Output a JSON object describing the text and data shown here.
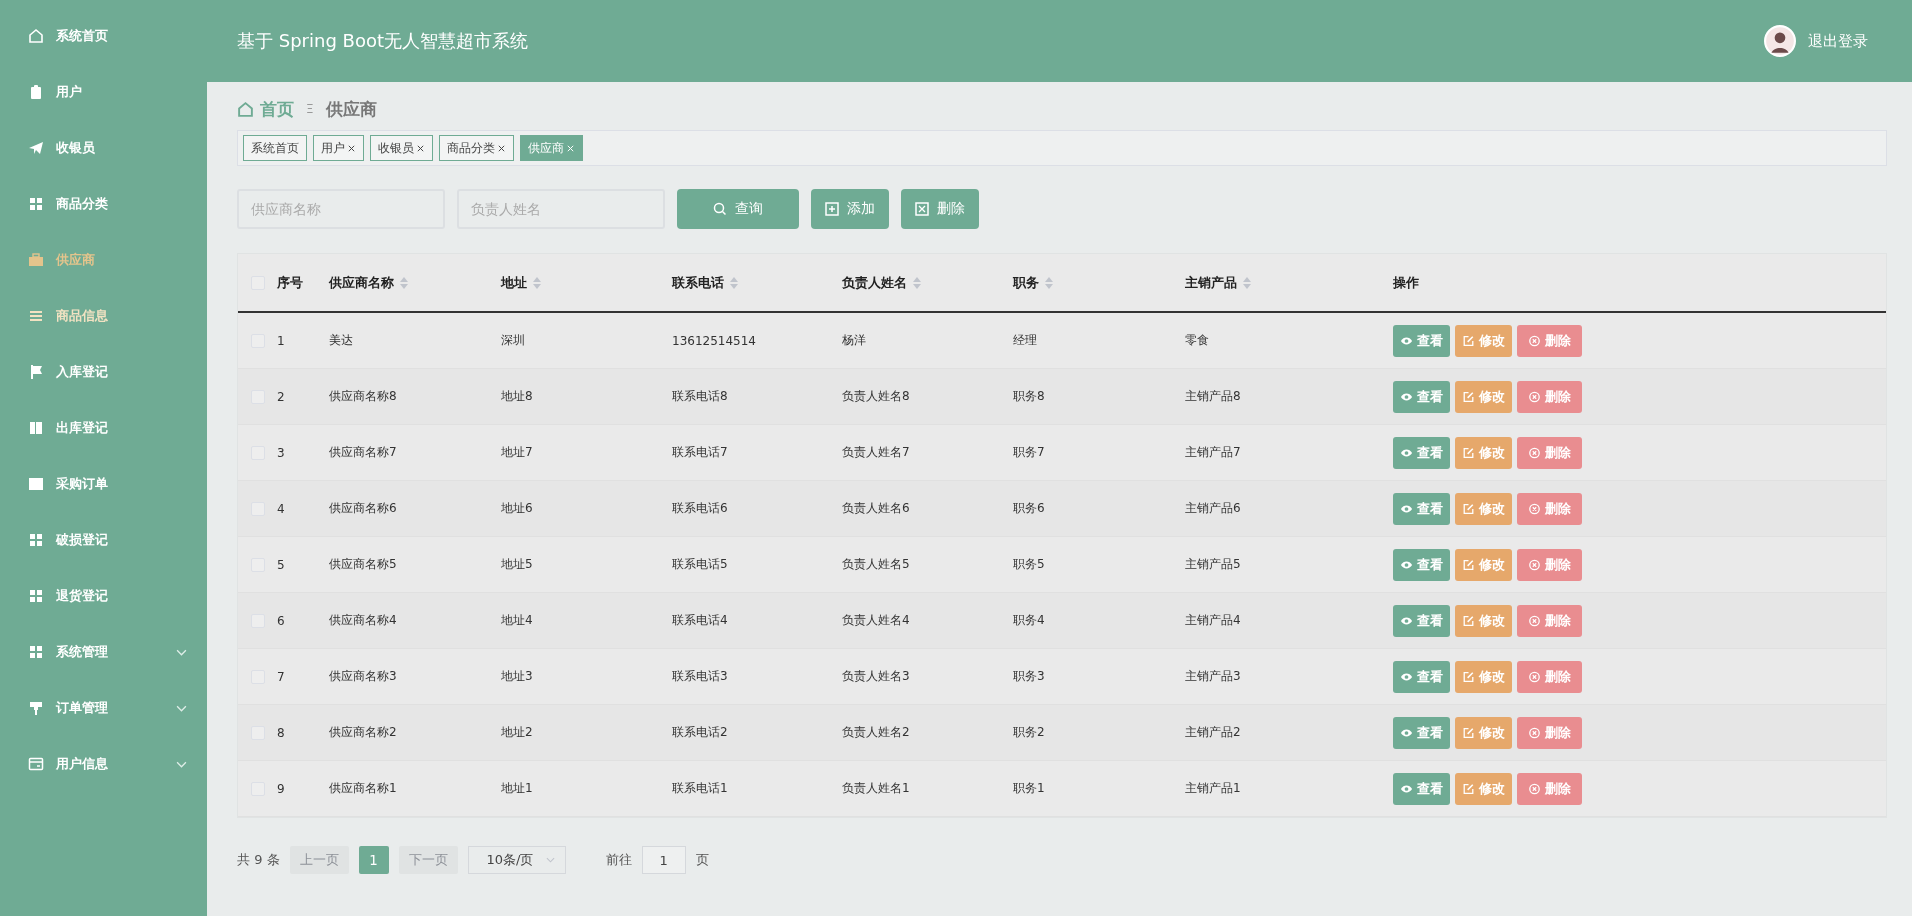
{
  "sidebar": {
    "items": [
      {
        "label": "系统首页",
        "kind": "link",
        "selected": false,
        "hovered": false
      },
      {
        "label": "用户",
        "kind": "link",
        "selected": false,
        "hovered": false
      },
      {
        "label": "收银员",
        "kind": "link",
        "selected": false,
        "hovered": false
      },
      {
        "label": "商品分类",
        "kind": "link",
        "selected": false,
        "hovered": false
      },
      {
        "label": "供应商",
        "kind": "link",
        "selected": true,
        "hovered": false
      },
      {
        "label": "商品信息",
        "kind": "link",
        "selected": false,
        "hovered": true
      },
      {
        "label": "入库登记",
        "kind": "link",
        "selected": false,
        "hovered": false
      },
      {
        "label": "出库登记",
        "kind": "link",
        "selected": false,
        "hovered": false
      },
      {
        "label": "采购订单",
        "kind": "link",
        "selected": false,
        "hovered": false
      },
      {
        "label": "破损登记",
        "kind": "link",
        "selected": false,
        "hovered": false
      },
      {
        "label": "退货登记",
        "kind": "link",
        "selected": false,
        "hovered": false
      },
      {
        "label": "系统管理",
        "kind": "submenu",
        "selected": false,
        "hovered": false
      },
      {
        "label": "订单管理",
        "kind": "submenu",
        "selected": false,
        "hovered": false
      },
      {
        "label": "用户信息",
        "kind": "submenu",
        "selected": false,
        "hovered": false
      }
    ]
  },
  "header": {
    "title": "基于 Spring Boot无人智慧超市系统",
    "logout": "退出登录"
  },
  "breadcrumb": {
    "home": "首页",
    "separator": "Ξ",
    "current": "供应商"
  },
  "tags": [
    {
      "label": "系统首页",
      "closable": false,
      "selected": false
    },
    {
      "label": "用户",
      "closable": true,
      "selected": false
    },
    {
      "label": "收银员",
      "closable": true,
      "selected": false
    },
    {
      "label": "商品分类",
      "closable": true,
      "selected": false
    },
    {
      "label": "供应商",
      "closable": true,
      "selected": true
    }
  ],
  "search": {
    "fields": [
      {
        "placeholder": "供应商名称"
      },
      {
        "placeholder": "负责人姓名"
      }
    ],
    "buttons": [
      {
        "label": "查询",
        "kind": "search"
      },
      {
        "label": "添加",
        "kind": "add"
      },
      {
        "label": "删除",
        "kind": "delete"
      }
    ]
  },
  "table": {
    "all_checked": false,
    "columns": [
      {
        "label": "序号",
        "sortable": false
      },
      {
        "label": "供应商名称",
        "sortable": true
      },
      {
        "label": "地址",
        "sortable": true
      },
      {
        "label": "联系电话",
        "sortable": true
      },
      {
        "label": "负责人姓名",
        "sortable": true
      },
      {
        "label": "职务",
        "sortable": true
      },
      {
        "label": "主销产品",
        "sortable": true
      },
      {
        "label": "操作",
        "sortable": false
      }
    ],
    "rows": [
      {
        "checked": false,
        "cells": [
          "1",
          "美达",
          "深圳",
          "13612514514",
          "杨洋",
          "经理",
          "零食"
        ],
        "actions": [
          {
            "label": "查看",
            "kind": "view"
          },
          {
            "label": "修改",
            "kind": "edit"
          },
          {
            "label": "删除",
            "kind": "delete"
          }
        ]
      },
      {
        "checked": false,
        "cells": [
          "2",
          "供应商名称8",
          "地址8",
          "联系电话8",
          "负责人姓名8",
          "职务8",
          "主销产品8"
        ],
        "actions": [
          {
            "label": "查看",
            "kind": "view"
          },
          {
            "label": "修改",
            "kind": "edit"
          },
          {
            "label": "删除",
            "kind": "delete"
          }
        ]
      },
      {
        "checked": false,
        "cells": [
          "3",
          "供应商名称7",
          "地址7",
          "联系电话7",
          "负责人姓名7",
          "职务7",
          "主销产品7"
        ],
        "actions": [
          {
            "label": "查看",
            "kind": "view"
          },
          {
            "label": "修改",
            "kind": "edit"
          },
          {
            "label": "删除",
            "kind": "delete"
          }
        ]
      },
      {
        "checked": false,
        "cells": [
          "4",
          "供应商名称6",
          "地址6",
          "联系电话6",
          "负责人姓名6",
          "职务6",
          "主销产品6"
        ],
        "actions": [
          {
            "label": "查看",
            "kind": "view"
          },
          {
            "label": "修改",
            "kind": "edit"
          },
          {
            "label": "删除",
            "kind": "delete"
          }
        ]
      },
      {
        "checked": false,
        "cells": [
          "5",
          "供应商名称5",
          "地址5",
          "联系电话5",
          "负责人姓名5",
          "职务5",
          "主销产品5"
        ],
        "actions": [
          {
            "label": "查看",
            "kind": "view"
          },
          {
            "label": "修改",
            "kind": "edit"
          },
          {
            "label": "删除",
            "kind": "delete"
          }
        ]
      },
      {
        "checked": false,
        "cells": [
          "6",
          "供应商名称4",
          "地址4",
          "联系电话4",
          "负责人姓名4",
          "职务4",
          "主销产品4"
        ],
        "actions": [
          {
            "label": "查看",
            "kind": "view"
          },
          {
            "label": "修改",
            "kind": "edit"
          },
          {
            "label": "删除",
            "kind": "delete"
          }
        ]
      },
      {
        "checked": false,
        "cells": [
          "7",
          "供应商名称3",
          "地址3",
          "联系电话3",
          "负责人姓名3",
          "职务3",
          "主销产品3"
        ],
        "actions": [
          {
            "label": "查看",
            "kind": "view"
          },
          {
            "label": "修改",
            "kind": "edit"
          },
          {
            "label": "删除",
            "kind": "delete"
          }
        ]
      },
      {
        "checked": false,
        "cells": [
          "8",
          "供应商名称2",
          "地址2",
          "联系电话2",
          "负责人姓名2",
          "职务2",
          "主销产品2"
        ],
        "actions": [
          {
            "label": "查看",
            "kind": "view"
          },
          {
            "label": "修改",
            "kind": "edit"
          },
          {
            "label": "删除",
            "kind": "delete"
          }
        ]
      },
      {
        "checked": false,
        "cells": [
          "9",
          "供应商名称1",
          "地址1",
          "联系电话1",
          "负责人姓名1",
          "职务1",
          "主销产品1"
        ],
        "actions": [
          {
            "label": "查看",
            "kind": "view"
          },
          {
            "label": "修改",
            "kind": "edit"
          },
          {
            "label": "删除",
            "kind": "delete"
          }
        ]
      }
    ]
  },
  "pagination": {
    "total": "共 9 条",
    "prev": {
      "label": "上一页",
      "disabled": true
    },
    "pages": [
      {
        "label": "1",
        "selected": true
      }
    ],
    "next": {
      "label": "下一页",
      "disabled": true
    },
    "page_size": "10条/页",
    "goto_label": "前往",
    "goto_value": "1",
    "goto_suffix": "页"
  }
}
